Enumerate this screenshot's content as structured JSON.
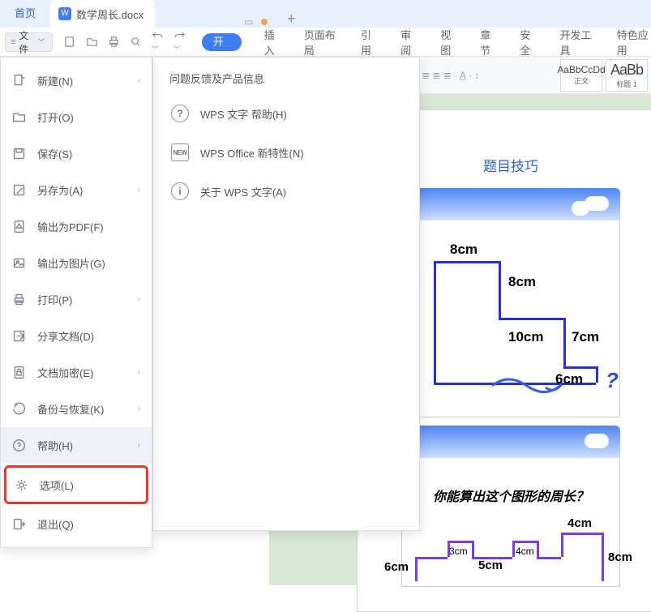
{
  "tabs": {
    "home": "首页",
    "doc": "数学周长.docx",
    "add": "+"
  },
  "file_btn": "文件",
  "ribbon": {
    "start": "开始",
    "tabs": [
      "插入",
      "页面布局",
      "引用",
      "审阅",
      "视图",
      "章节",
      "安全",
      "开发工具",
      "特色应用"
    ]
  },
  "styles": {
    "s1_preview": "AaBbCcDd",
    "s1_name": "正文",
    "s2_preview": "AaBb",
    "s2_name": "标题 1"
  },
  "menu1": {
    "new": "新建(N)",
    "open": "打开(O)",
    "save": "保存(S)",
    "saveas": "另存为(A)",
    "pdf": "输出为PDF(F)",
    "img": "输出为图片(G)",
    "print": "打印(P)",
    "share": "分享文档(D)",
    "encrypt": "文档加密(E)",
    "backup": "备份与恢复(K)",
    "help": "帮助(H)",
    "options": "选项(L)",
    "exit": "退出(Q)"
  },
  "menu2": {
    "header": "问题反馈及产品信息",
    "help": "WPS 文字 帮助(H)",
    "new": "WPS Office 新特性(N)",
    "about": "关于 WPS 文字(A)"
  },
  "doc": {
    "heading_suffix": "题目技巧",
    "fig1": {
      "top": "8cm",
      "r1": "8cm",
      "mid": "10cm",
      "r2": "7cm",
      "bot": "6cm",
      "q": "?"
    },
    "fig2": {
      "title": "你能算出这个图形的周长？",
      "left": "6cm",
      "s1": "3cm",
      "mid": "5cm",
      "s2": "4cm",
      "top": "4cm",
      "right": "8cm"
    }
  }
}
